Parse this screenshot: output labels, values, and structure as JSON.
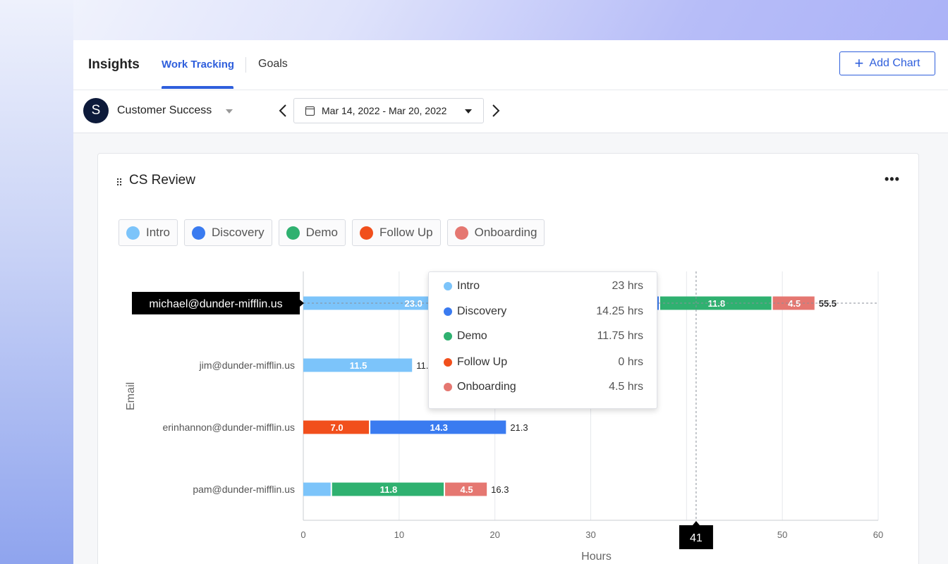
{
  "header": {
    "title": "Insights",
    "tabs": [
      {
        "label": "Work Tracking",
        "active": true
      },
      {
        "label": "Goals",
        "active": false
      }
    ],
    "add_chart_label": "Add Chart"
  },
  "filters": {
    "team_initial": "S",
    "team_name": "Customer Success",
    "date_range": "Mar 14, 2022 - Mar 20, 2022"
  },
  "card": {
    "title": "CS Review",
    "legend": [
      {
        "label": "Intro",
        "color": "#7cc4fa"
      },
      {
        "label": "Discovery",
        "color": "#3a7bf0"
      },
      {
        "label": "Demo",
        "color": "#2fb170"
      },
      {
        "label": "Follow Up",
        "color": "#f14f1c"
      },
      {
        "label": "Onboarding",
        "color": "#e57771"
      }
    ]
  },
  "tooltip": {
    "rows": [
      {
        "label": "Intro",
        "value": "23 hrs",
        "color": "#7cc4fa"
      },
      {
        "label": "Discovery",
        "value": "14.25 hrs",
        "color": "#3a7bf0"
      },
      {
        "label": "Demo",
        "value": "11.75 hrs",
        "color": "#2fb170"
      },
      {
        "label": "Follow Up",
        "value": "0 hrs",
        "color": "#f14f1c"
      },
      {
        "label": "Onboarding",
        "value": "4.5 hrs",
        "color": "#e57771"
      }
    ]
  },
  "chart_data": {
    "type": "bar",
    "orientation": "horizontal",
    "stacked": true,
    "xlabel": "Hours",
    "ylabel": "Email",
    "xlim": [
      0,
      60
    ],
    "xticks": [
      0,
      10,
      20,
      30,
      40,
      50,
      60
    ],
    "crosshair_value": 41,
    "crosshair_label": "41",
    "hovered_category": "michael@dunder-mifflin.us",
    "categories": [
      "michael@dunder-mifflin.us",
      "jim@dunder-mifflin.us",
      "erinhannon@dunder-mifflin.us",
      "pam@dunder-mifflin.us"
    ],
    "series": [
      {
        "name": "Intro",
        "color": "#7cc4fa",
        "values": [
          23.0,
          11.5,
          0,
          3.0
        ],
        "labels": [
          "23.0",
          "11.5",
          "",
          ""
        ]
      },
      {
        "name": "Discovery",
        "color": "#3a7bf0",
        "values": [
          14.25,
          0,
          14.3,
          0
        ],
        "labels": [
          "",
          "",
          "14.3",
          ""
        ]
      },
      {
        "name": "Demo",
        "color": "#2fb170",
        "values": [
          11.75,
          0,
          0,
          11.8
        ],
        "labels": [
          "11.8",
          "",
          "",
          "11.8"
        ]
      },
      {
        "name": "Follow Up",
        "color": "#f14f1c",
        "values": [
          0,
          0,
          7.0,
          0
        ],
        "labels": [
          "",
          "",
          "7.0",
          ""
        ]
      },
      {
        "name": "Onboarding",
        "color": "#e57771",
        "values": [
          4.5,
          0,
          0,
          4.5
        ],
        "labels": [
          "4.5",
          "",
          "",
          "4.5"
        ]
      }
    ],
    "totals": [
      "55.5",
      "11.5",
      "21.3",
      "16.3"
    ],
    "stack_order": [
      [
        "Intro",
        "Discovery",
        "Demo",
        "Follow Up",
        "Onboarding"
      ],
      [
        "Intro",
        "Discovery",
        "Demo",
        "Follow Up",
        "Onboarding"
      ],
      [
        "Follow Up",
        "Discovery",
        "Intro",
        "Demo",
        "Onboarding"
      ],
      [
        "Intro",
        "Discovery",
        "Demo",
        "Follow Up",
        "Onboarding"
      ]
    ]
  }
}
